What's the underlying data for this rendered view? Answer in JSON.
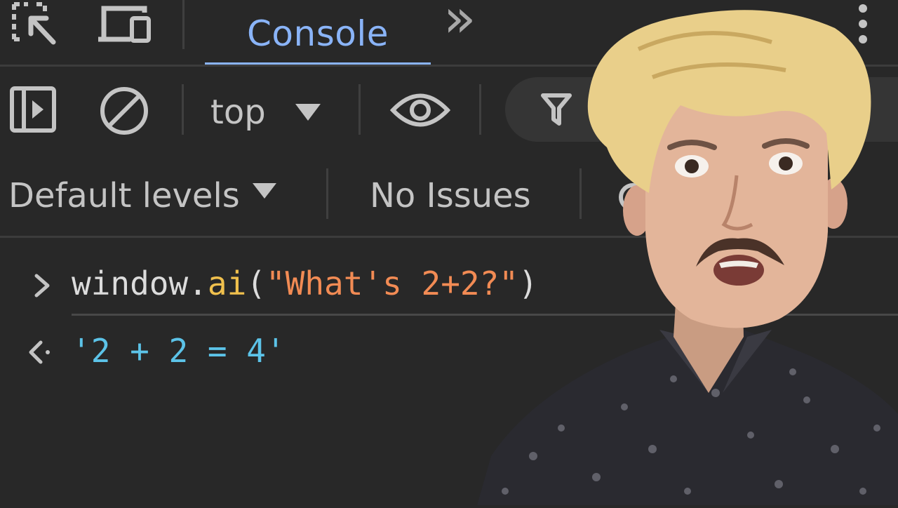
{
  "tabbar": {
    "console_tab": "Console",
    "more_tabs": "»"
  },
  "toolbar1": {
    "context_label": "top"
  },
  "toolbar2": {
    "levels_label": "Default levels",
    "issues_label": "No Issues"
  },
  "console": {
    "input": {
      "obj": "window.",
      "fn": "ai",
      "open": "(",
      "arg": "\"What's 2+2?\"",
      "close": ")"
    },
    "output": "'2 + 2 = 4'"
  },
  "colors": {
    "background": "#282828",
    "accent": "#8ab4f8",
    "function": "#f0c04d",
    "string": "#f28b54",
    "result": "#5cc3e8"
  }
}
